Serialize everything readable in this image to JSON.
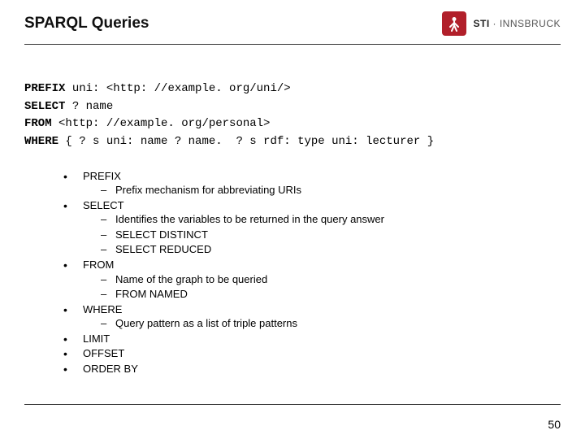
{
  "header": {
    "title": "SPARQL Queries",
    "logo_main": "STI",
    "logo_sub": " · INNSBRUCK"
  },
  "code": {
    "l1a": "PREFIX",
    "l1b": " uni: <http: //example. org/uni/>",
    "l2a": "SELECT",
    "l2b": " ? name",
    "l3a": "FROM",
    "l3b": " <http: //example. org/personal>",
    "l4a": "WHERE",
    "l4b": " { ? s uni: name ? name.  ? s rdf: type uni: lecturer }"
  },
  "bullets": [
    {
      "label": "PREFIX",
      "subs": [
        "Prefix mechanism for abbreviating URIs"
      ]
    },
    {
      "label": "SELECT",
      "subs": [
        "Identifies the variables to be returned in the query answer",
        "SELECT DISTINCT",
        "SELECT REDUCED"
      ]
    },
    {
      "label": "FROM",
      "subs": [
        "Name of the graph to be queried",
        "FROM NAMED"
      ]
    },
    {
      "label": "WHERE",
      "subs": [
        "Query pattern as a list of triple patterns"
      ]
    },
    {
      "label": "LIMIT",
      "subs": []
    },
    {
      "label": "OFFSET",
      "subs": []
    },
    {
      "label": "ORDER BY",
      "subs": []
    }
  ],
  "page": "50"
}
